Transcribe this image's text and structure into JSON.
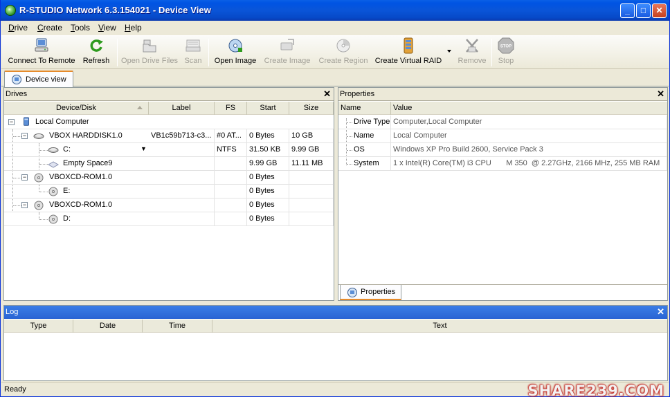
{
  "window": {
    "title": "R-STUDIO Network 6.3.154021 - Device View",
    "controls": {
      "minimize": "_",
      "maximize": "□",
      "close": "✕"
    }
  },
  "menu": [
    {
      "label": "Drive"
    },
    {
      "label": "Create"
    },
    {
      "label": "Tools"
    },
    {
      "label": "View"
    },
    {
      "label": "Help"
    }
  ],
  "toolbar": {
    "connect_to_remote": {
      "label": "Connect To Remote",
      "icon": "network-computer-icon",
      "enabled": true
    },
    "refresh": {
      "label": "Refresh",
      "icon": "refresh-icon",
      "enabled": true
    },
    "open_drive_files": {
      "label": "Open Drive Files",
      "icon": "folder-icon",
      "enabled": false
    },
    "scan": {
      "label": "Scan",
      "icon": "scanner-icon",
      "enabled": false
    },
    "open_image": {
      "label": "Open Image",
      "icon": "open-image-icon",
      "enabled": true
    },
    "create_image": {
      "label": "Create Image",
      "icon": "create-image-icon",
      "enabled": false
    },
    "create_region": {
      "label": "Create Region",
      "icon": "disc-icon",
      "enabled": false
    },
    "create_virtual_raid": {
      "label": "Create Virtual RAID",
      "icon": "raid-icon",
      "enabled": true
    },
    "remove": {
      "label": "Remove",
      "icon": "remove-icon",
      "enabled": false
    },
    "stop": {
      "label": "Stop",
      "icon": "stop-icon",
      "enabled": false
    }
  },
  "doc_tab": {
    "label": "Device view"
  },
  "drives_panel": {
    "title": "Drives",
    "columns": [
      "Device/Disk",
      "Label",
      "FS",
      "Start",
      "Size"
    ],
    "rows": [
      {
        "name": "Local Computer",
        "label": "",
        "fs": "",
        "start": "",
        "size": ""
      },
      {
        "name": "VBOX HARDDISK1.0",
        "label": "VB1c59b713-c3...",
        "fs": "#0 AT...",
        "start": "0 Bytes",
        "size": "10 GB"
      },
      {
        "name": "C:",
        "label": "",
        "fs": "NTFS",
        "start": "31.50 KB",
        "size": "9.99 GB"
      },
      {
        "name": "Empty Space9",
        "label": "",
        "fs": "",
        "start": "9.99 GB",
        "size": "11.11 MB"
      },
      {
        "name": "VBOXCD-ROM1.0",
        "label": "",
        "fs": "",
        "start": "0 Bytes",
        "size": ""
      },
      {
        "name": "E:",
        "label": "",
        "fs": "",
        "start": "0 Bytes",
        "size": ""
      },
      {
        "name": "VBOXCD-ROM1.0",
        "label": "",
        "fs": "",
        "start": "0 Bytes",
        "size": ""
      },
      {
        "name": "D:",
        "label": "",
        "fs": "",
        "start": "0 Bytes",
        "size": ""
      }
    ]
  },
  "properties_panel": {
    "title": "Properties",
    "columns": [
      "Name",
      "Value"
    ],
    "rows": [
      {
        "name": "Drive Type",
        "value": "Computer,Local Computer"
      },
      {
        "name": "Name",
        "value": "Local Computer"
      },
      {
        "name": "OS",
        "value": "Windows XP Pro Build 2600, Service Pack 3"
      },
      {
        "name": "System",
        "value": "1 x Intel(R) Core(TM) i3 CPU       M 350  @ 2.27GHz, 2166 MHz, 255 MB RAM"
      }
    ],
    "tab_label": "Properties"
  },
  "log_panel": {
    "title": "Log",
    "columns": [
      "Type",
      "Date",
      "Time",
      "Text"
    ]
  },
  "status": {
    "text": "Ready"
  },
  "watermark": "SHARE239.COM",
  "colors": {
    "titlebar": "#0054e3",
    "accent_tab": "#e68b2c",
    "log_header": "#2a64d4"
  }
}
